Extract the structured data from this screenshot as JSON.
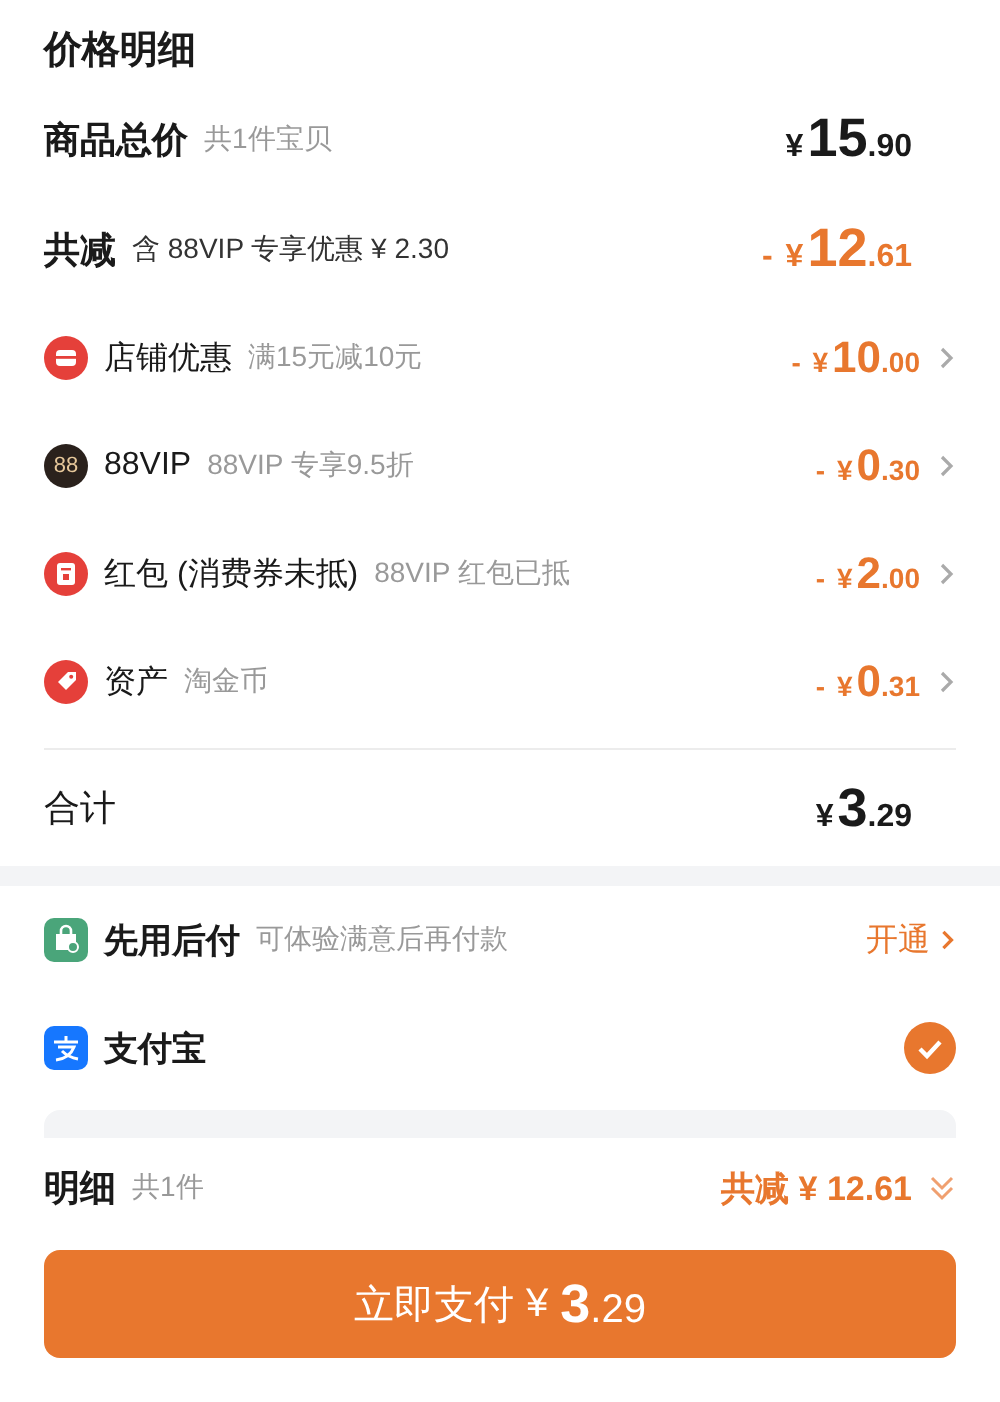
{
  "title": "价格明细",
  "summary": [
    {
      "label": "商品总价",
      "note": "共1件宝贝",
      "kind": "subtotal",
      "amount": {
        "symbol": "¥",
        "whole": "15",
        "fraction": ".90"
      }
    },
    {
      "label": "共减",
      "note": "含 88VIP 专享优惠 ¥ 2.30",
      "kind": "saving",
      "amount": {
        "sign": "-",
        "symbol": "¥",
        "whole": "12",
        "fraction": ".61"
      }
    }
  ],
  "discounts": [
    {
      "kind": "store",
      "label": "店铺优惠",
      "note": "满15元减10元",
      "amount": {
        "sign": "-",
        "symbol": "¥",
        "whole": "10",
        "fraction": ".00"
      }
    },
    {
      "kind": "vip",
      "icon_text": "88",
      "label": "88VIP",
      "note": "88VIP 专享9.5折",
      "amount": {
        "sign": "-",
        "symbol": "¥",
        "whole": "0",
        "fraction": ".30"
      }
    },
    {
      "kind": "redpacket",
      "label": "红包 (消费券未抵)",
      "note": "88VIP 红包已抵",
      "amount": {
        "sign": "-",
        "symbol": "¥",
        "whole": "2",
        "fraction": ".00"
      }
    },
    {
      "kind": "asset",
      "label": "资产",
      "note": "淘金币",
      "amount": {
        "sign": "-",
        "symbol": "¥",
        "whole": "0",
        "fraction": ".31"
      }
    }
  ],
  "total": {
    "label": "合计",
    "amount": {
      "symbol": "¥",
      "whole": "3",
      "fraction": ".29"
    }
  },
  "payment_methods": [
    {
      "kind": "bnpl",
      "label": "先用后付",
      "note": "可体验满意后再付款",
      "action": "开通"
    },
    {
      "kind": "alipay",
      "label": "支付宝",
      "selected": true
    }
  ],
  "footer": {
    "label": "明细",
    "count": "共1件",
    "saving": "共减 ¥ 12.61"
  },
  "pay_button": {
    "label": "立即支付",
    "symbol": "¥",
    "whole": "3",
    "fraction": ".29"
  }
}
